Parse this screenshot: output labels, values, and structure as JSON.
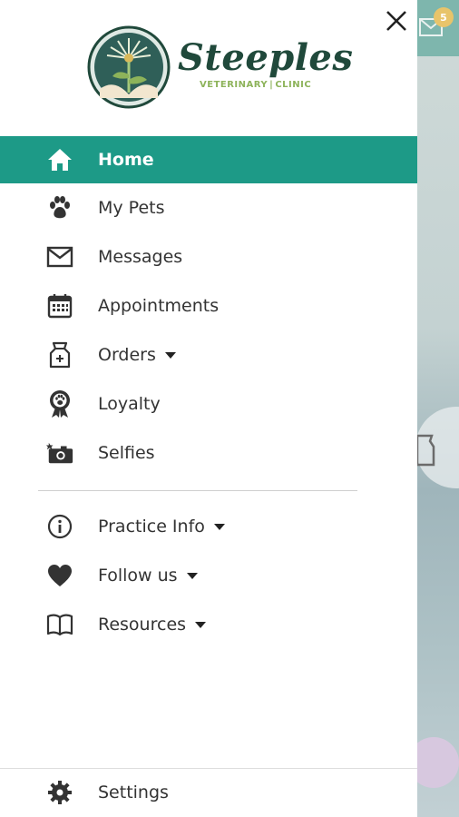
{
  "logo": {
    "name": "Steeples",
    "sub_left": "VETERINARY",
    "sub_right": "CLINIC"
  },
  "background": {
    "badge_count": "5"
  },
  "menu": {
    "items": [
      {
        "label": "Home",
        "icon": "home-icon",
        "active": true
      },
      {
        "label": "My Pets",
        "icon": "paw-icon"
      },
      {
        "label": "Messages",
        "icon": "envelope-icon"
      },
      {
        "label": "Appointments",
        "icon": "calendar-icon"
      },
      {
        "label": "Orders",
        "icon": "food-bag-icon",
        "dropdown": true
      },
      {
        "label": "Loyalty",
        "icon": "award-ribbon-icon"
      },
      {
        "label": "Selfies",
        "icon": "camera-icon"
      }
    ],
    "secondary": [
      {
        "label": "Practice Info",
        "icon": "info-icon",
        "dropdown": true
      },
      {
        "label": "Follow us",
        "icon": "heart-icon",
        "dropdown": true
      },
      {
        "label": "Resources",
        "icon": "book-icon",
        "dropdown": true
      }
    ],
    "settings_label": "Settings"
  },
  "colors": {
    "accent": "#1d9a87",
    "logo_dark": "#20493b",
    "logo_green": "#8db35a"
  }
}
